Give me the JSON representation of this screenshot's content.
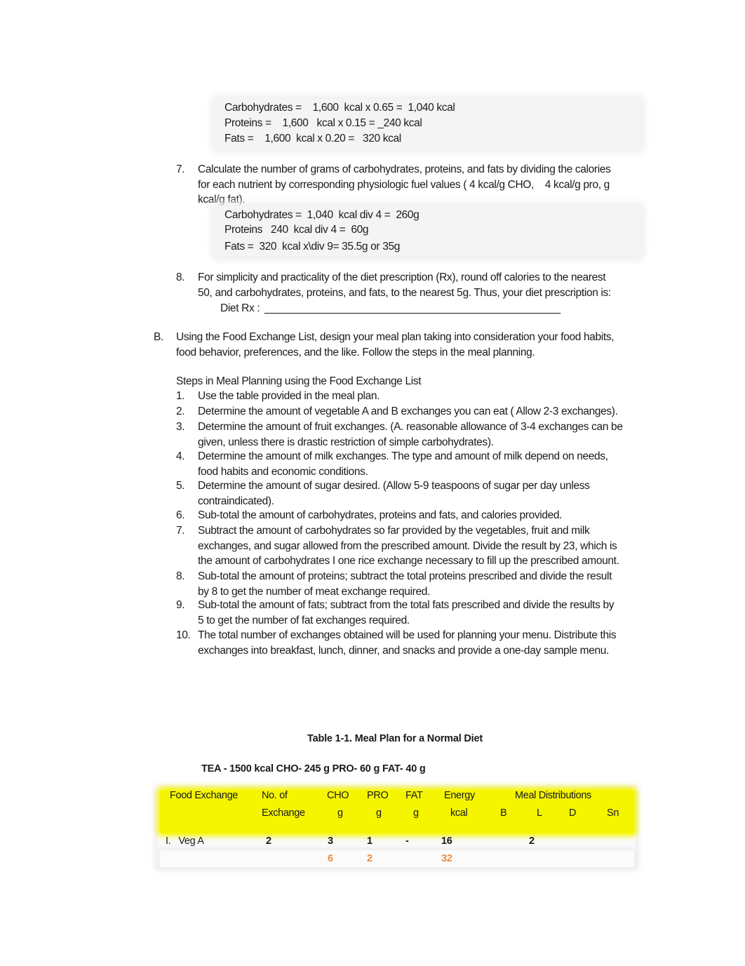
{
  "calc_box_1": {
    "lines": [
      "Carbohydrates =    1,600  kcal x 0.65 =  1,040 kcal",
      "Proteins =    1,600   kcal x 0.15 = _240 kcal",
      "Fats =    1,600  kcal x 0.20 =   320 kcal"
    ]
  },
  "step7": {
    "number": "7.",
    "lines": [
      "Calculate the number of grams of carbohydrates, proteins, and fats by dividing the calories",
      "for each nutrient by corresponding physiologic fuel values ( 4 kcal/g CHO,    4 kcal/g pro, g",
      "kcal/g fat)."
    ],
    "calc": [
      "Carbohydrates =  1,040  kcal div 4 =  260g",
      "Proteins   240  kcal div 4 =  60g",
      "Fats =  320  kcal x\\div 9= 35.5g or 35g"
    ]
  },
  "step8": {
    "number": "8.",
    "lines": [
      "For simplicity and practicality of the diet prescription (Rx), round off calories to the nearest",
      "50, and carbohydrates, proteins, and fats, to the nearest 5g. Thus, your diet prescription is:"
    ],
    "diet_rx_label": "Diet Rx :",
    "diet_rx_blank": "___________________________________________________"
  },
  "section_b": {
    "letter": "B.",
    "lines": [
      "Using the Food Exchange List, design your meal plan taking into consideration your food habits,",
      "food behavior, preferences, and the like. Follow the steps in the meal planning."
    ],
    "steps_title": "Steps in Meal Planning using the Food Exchange List",
    "steps": [
      {
        "num": "1.",
        "lines": [
          "Use the table provided in the meal plan."
        ]
      },
      {
        "num": "2.",
        "lines": [
          "Determine the amount of vegetable A and B exchanges you can eat ( Allow 2-3 exchanges)."
        ]
      },
      {
        "num": "3.",
        "lines": [
          "Determine the amount of fruit exchanges. (A. reasonable allowance of 3-4 exchanges can be",
          "given, unless there is drastic restriction of simple carbohydrates)."
        ]
      },
      {
        "num": "4.",
        "lines": [
          "Determine the amount of milk exchanges. The type and amount of milk depend on needs,",
          "food habits and economic conditions."
        ]
      },
      {
        "num": "5.",
        "lines": [
          "Determine the amount of sugar desired. (Allow 5-9 teaspoons of sugar per day unless",
          "contraindicated)."
        ]
      },
      {
        "num": "6.",
        "lines": [
          "Sub-total the amount of carbohydrates, proteins and fats, and calories provided."
        ]
      },
      {
        "num": "7.",
        "lines": [
          "Subtract the amount of carbohydrates so far provided by the vegetables, fruit and milk",
          "exchanges, and sugar allowed from the prescribed amount. Divide the result by 23, which is",
          "the amount of carbohydrates I one rice exchange necessary to fill up the prescribed amount."
        ]
      },
      {
        "num": "8.",
        "lines": [
          "Sub-total the amount of proteins; subtract the total proteins prescribed and divide the result",
          "by 8 to get the number of meat exchange required."
        ]
      },
      {
        "num": "9.",
        "lines": [
          "Sub-total the amount of fats; subtract from the total fats prescribed and divide the results by",
          "5 to get the number of fat exchanges required."
        ]
      },
      {
        "num": "10.",
        "lines": [
          "The total number of exchanges obtained will be used for planning your menu. Distribute this",
          "exchanges into breakfast, lunch, dinner, and snacks and provide a one-day sample menu."
        ]
      }
    ]
  },
  "table": {
    "title": "Table 1-1. Meal Plan for a Normal Diet",
    "tea_line": "TEA - 1500 kcal CHO- 245 g PRO- 60 g FAT- 40 g",
    "header": {
      "food_exchange": "Food Exchange",
      "no_of": "No. of",
      "exchange": "Exchange",
      "cho": "CHO",
      "pro": "PRO",
      "fat": "FAT",
      "energy": "Energy",
      "g": "g",
      "kcal": "kcal",
      "meal_distributions": "Meal Distributions",
      "b": "B",
      "l": "L",
      "d": "D",
      "sn": "Sn"
    },
    "rows": [
      {
        "label": "I.   Veg A",
        "no_of_exchange": "2",
        "cho": "3",
        "pro": "1",
        "fat": "-",
        "energy": "16",
        "b": "",
        "l": "2",
        "d": "",
        "sn": "",
        "totals": {
          "cho": "6",
          "pro": "2",
          "fat": "",
          "energy": "32"
        }
      }
    ],
    "colors": {
      "header_highlight": "#f5f500",
      "total_values": "#f08a3c"
    }
  }
}
